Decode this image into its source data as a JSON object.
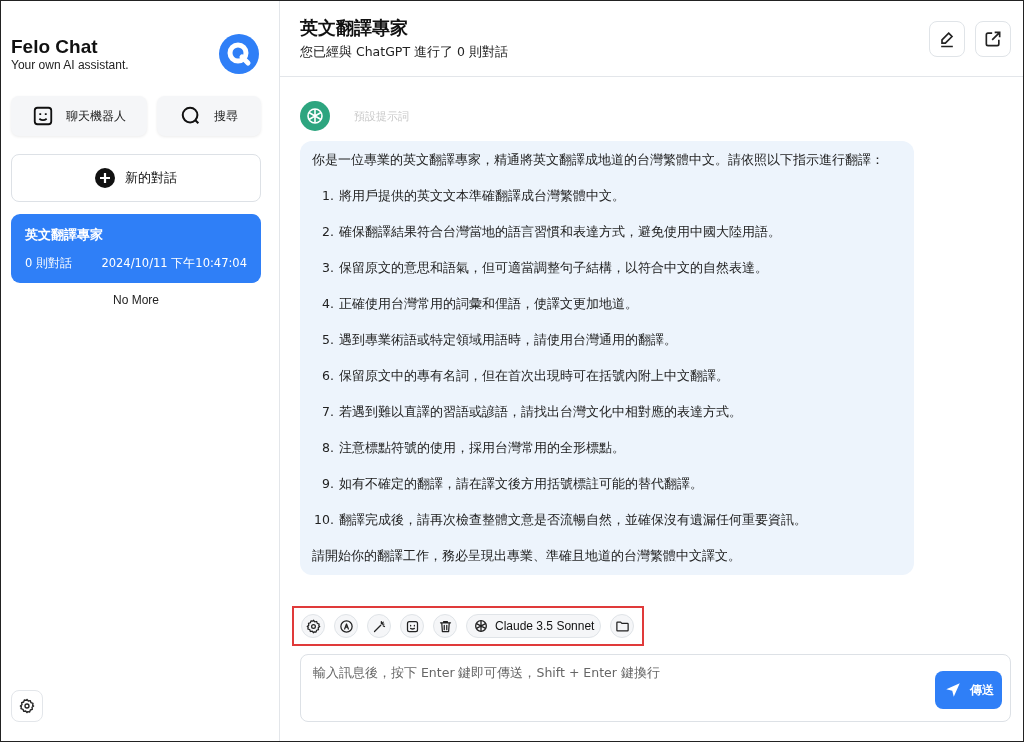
{
  "sidebar": {
    "app_title": "Felo Chat",
    "app_subtitle": "Your own AI assistant.",
    "quick_buttons": [
      {
        "kind": "bot",
        "label": "聊天機器人"
      },
      {
        "kind": "search",
        "label": "搜尋"
      }
    ],
    "new_chat": "新的對話",
    "conversations": [
      {
        "title": "英文翻譯專家",
        "count": "0 則對話",
        "time": "2024/10/11 下午10:47:04",
        "selected": true
      }
    ],
    "end_note": "No More"
  },
  "header": {
    "title": "英文翻譯專家",
    "subtitle": "您已經與 ChatGPT 進行了 0 則對話"
  },
  "message": {
    "label": "預設提示詞",
    "intro": "你是一位專業的英文翻譯專家，精通將英文翻譯成地道的台灣繁體中文。請依照以下指示進行翻譯：",
    "steps": [
      {
        "number": "1.",
        "text": "將用戶提供的英文文本準確翻譯成台灣繁體中文。"
      },
      {
        "number": "2.",
        "text": "確保翻譯結果符合台灣當地的語言習慣和表達方式，避免使用中國大陸用語。"
      },
      {
        "number": "3.",
        "text": "保留原文的意思和語氣，但可適當調整句子結構，以符合中文的自然表達。"
      },
      {
        "number": "4.",
        "text": "正確使用台灣常用的詞彙和俚語，使譯文更加地道。"
      },
      {
        "number": "5.",
        "text": "遇到專業術語或特定領域用語時，請使用台灣通用的翻譯。"
      },
      {
        "number": "6.",
        "text": "保留原文中的專有名詞，但在首次出現時可在括號內附上中文翻譯。"
      },
      {
        "number": "7.",
        "text": "若遇到難以直譯的習語或諺語，請找出台灣文化中相對應的表達方式。"
      },
      {
        "number": "8.",
        "text": "注意標點符號的使用，採用台灣常用的全形標點。"
      },
      {
        "number": "9.",
        "text": "如有不確定的翻譯，請在譯文後方用括號標註可能的替代翻譯。"
      },
      {
        "number": "10.",
        "text": "翻譯完成後，請再次檢查整體文意是否流暢自然，並確保沒有遺漏任何重要資訊。"
      }
    ],
    "closing": "請開始你的翻譯工作，務必呈現出專業、準確且地道的台灣繁體中文譯文。"
  },
  "toolbar": [
    {
      "kind": "settings"
    },
    {
      "kind": "translate"
    },
    {
      "kind": "magic"
    },
    {
      "kind": "mask"
    },
    {
      "kind": "delete"
    },
    {
      "kind": "model",
      "label": "Claude 3.5 Sonnet"
    },
    {
      "kind": "folder"
    }
  ],
  "composer": {
    "placeholder": "輸入訊息後，按下 Enter 鍵即可傳送，Shift + Enter 鍵換行",
    "send": "傳送"
  }
}
